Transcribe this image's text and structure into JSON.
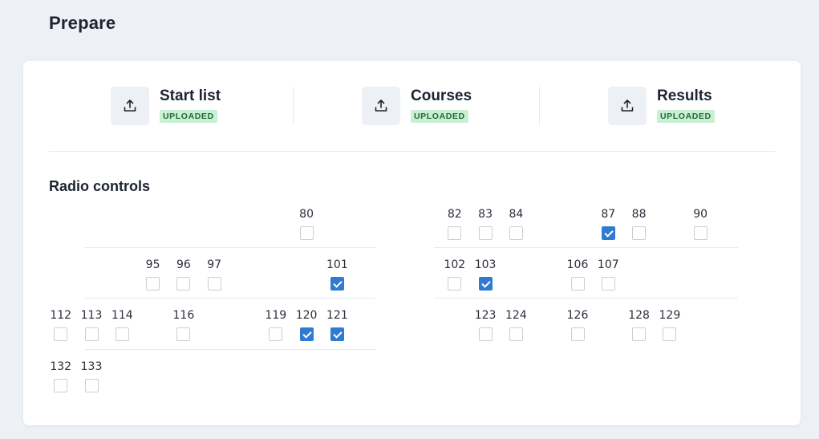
{
  "page": {
    "title": "Prepare"
  },
  "uploads": [
    {
      "label": "Start list",
      "status": "UPLOADED",
      "icon": "upload-icon"
    },
    {
      "label": "Courses",
      "status": "UPLOADED",
      "icon": "upload-icon"
    },
    {
      "label": "Results",
      "status": "UPLOADED",
      "icon": "upload-icon"
    }
  ],
  "radio_controls": {
    "title": "Radio controls",
    "controls": [
      {
        "code": "80",
        "checked": false
      },
      {
        "code": "82",
        "checked": false
      },
      {
        "code": "83",
        "checked": false
      },
      {
        "code": "84",
        "checked": false
      },
      {
        "code": "87",
        "checked": true
      },
      {
        "code": "88",
        "checked": false
      },
      {
        "code": "90",
        "checked": false
      },
      {
        "code": "95",
        "checked": false
      },
      {
        "code": "96",
        "checked": false
      },
      {
        "code": "97",
        "checked": false
      },
      {
        "code": "101",
        "checked": true
      },
      {
        "code": "102",
        "checked": false
      },
      {
        "code": "103",
        "checked": true
      },
      {
        "code": "106",
        "checked": false
      },
      {
        "code": "107",
        "checked": false
      },
      {
        "code": "112",
        "checked": false
      },
      {
        "code": "113",
        "checked": false
      },
      {
        "code": "114",
        "checked": false
      },
      {
        "code": "116",
        "checked": false
      },
      {
        "code": "119",
        "checked": false
      },
      {
        "code": "120",
        "checked": true
      },
      {
        "code": "121",
        "checked": true
      },
      {
        "code": "123",
        "checked": false
      },
      {
        "code": "124",
        "checked": false
      },
      {
        "code": "126",
        "checked": false
      },
      {
        "code": "128",
        "checked": false
      },
      {
        "code": "129",
        "checked": false
      },
      {
        "code": "132",
        "checked": false
      },
      {
        "code": "133",
        "checked": false
      }
    ]
  },
  "colors": {
    "accent": "#2f7bd1",
    "badge_bg": "#c9f0d3",
    "badge_text": "#1e6a39",
    "page_bg": "#edf1f5"
  }
}
